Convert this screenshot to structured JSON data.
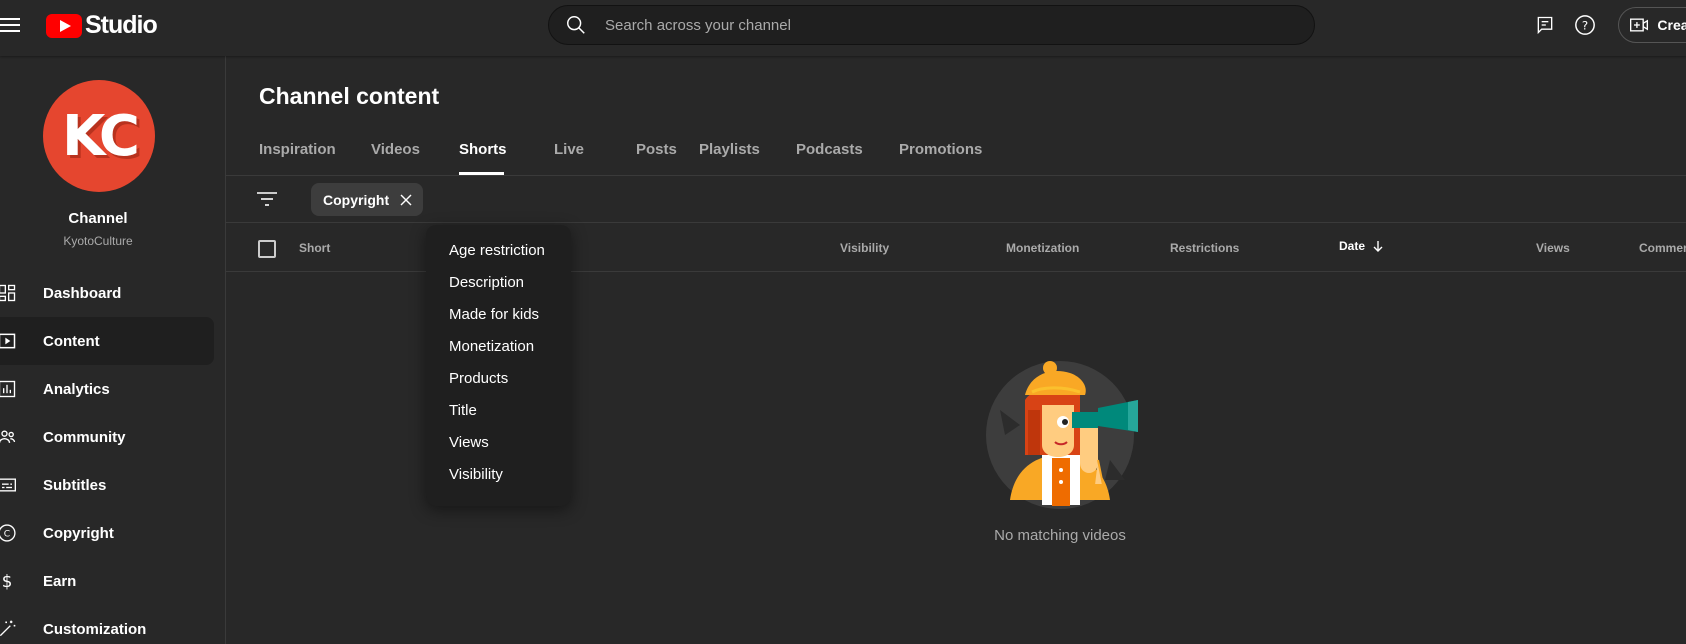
{
  "app": {
    "logo_text": "Studio"
  },
  "search": {
    "placeholder": "Search across your channel"
  },
  "header": {
    "create_label": "Create"
  },
  "sidebar": {
    "avatar_initials": "KC",
    "channel_label": "Channel",
    "channel_handle": "KyotoCulture",
    "items": [
      {
        "label": "Dashboard",
        "icon": "dashboard-icon"
      },
      {
        "label": "Content",
        "icon": "content-icon",
        "active": true
      },
      {
        "label": "Analytics",
        "icon": "analytics-icon"
      },
      {
        "label": "Community",
        "icon": "community-icon"
      },
      {
        "label": "Subtitles",
        "icon": "subtitles-icon"
      },
      {
        "label": "Copyright",
        "icon": "copyright-icon"
      },
      {
        "label": "Earn",
        "icon": "dollar-icon"
      },
      {
        "label": "Customization",
        "icon": "magic-wand-icon"
      }
    ]
  },
  "main": {
    "title": "Channel content",
    "tabs": [
      {
        "label": "Inspiration"
      },
      {
        "label": "Videos"
      },
      {
        "label": "Shorts",
        "active": true
      },
      {
        "label": "Live"
      },
      {
        "label": "Posts"
      },
      {
        "label": "Playlists"
      },
      {
        "label": "Podcasts"
      },
      {
        "label": "Promotions"
      }
    ],
    "filter_chip": "Copyright",
    "columns": {
      "short": "Short",
      "visibility": "Visibility",
      "monetization": "Monetization",
      "restrictions": "Restrictions",
      "date": "Date",
      "views": "Views",
      "comments": "Commen"
    },
    "empty_text": "No matching videos"
  },
  "dropdown": {
    "items": [
      "Age restriction",
      "Description",
      "Made for kids",
      "Monetization",
      "Products",
      "Title",
      "Views",
      "Visibility"
    ]
  },
  "colors": {
    "brand_red": "#ff0000",
    "avatar_bg": "#e5462f",
    "background": "#282828"
  }
}
